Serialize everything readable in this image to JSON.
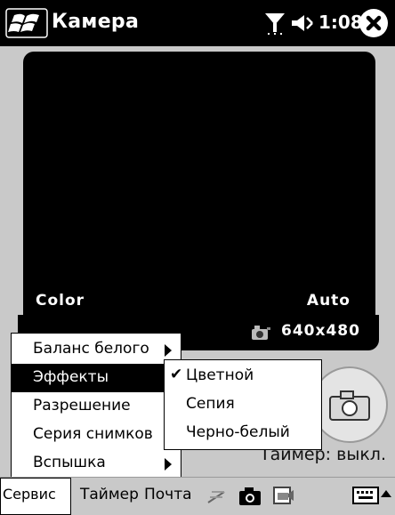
{
  "titlebar": {
    "app_title": "Камера",
    "clock": "1:08",
    "icons": [
      "windows-start-icon",
      "signal-icon",
      "volume-icon",
      "close-icon"
    ]
  },
  "viewfinder": {
    "effect_label": "Color",
    "white_balance_label": "Auto",
    "resolution_label": "640x480"
  },
  "timer_status": "Таймер: выкл.",
  "service_menu": {
    "items": [
      {
        "label": "Баланс белого",
        "has_submenu": true
      },
      {
        "label": "Эффекты",
        "has_submenu": true,
        "selected": true
      },
      {
        "label": "Разрешение",
        "has_submenu": true
      },
      {
        "label": "Серия снимков",
        "has_submenu": true
      },
      {
        "label": "Вспышка",
        "has_submenu": true
      }
    ]
  },
  "effects_submenu": {
    "items": [
      {
        "label": "Цветной",
        "checked": true
      },
      {
        "label": "Сепия",
        "checked": false
      },
      {
        "label": "Черно-белый",
        "checked": false
      }
    ]
  },
  "menubar": {
    "service": "Сервис",
    "timer": "Таймер",
    "mail": "Почта",
    "icons": [
      "wireless-icon",
      "camera-icon",
      "video-icon",
      "keyboard-icon",
      "arrow-up-icon"
    ]
  }
}
